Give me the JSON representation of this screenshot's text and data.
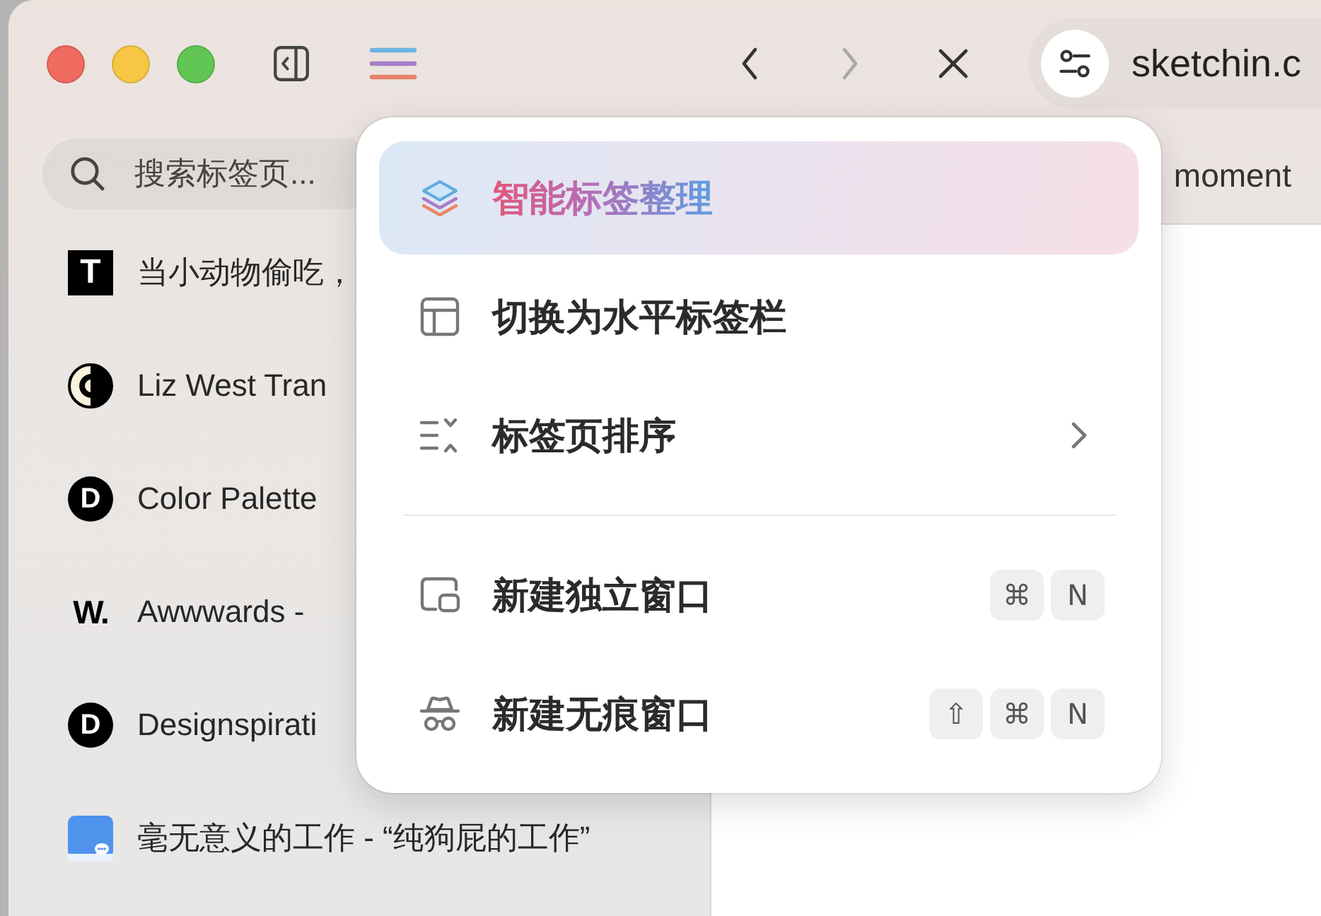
{
  "toolbar": {
    "back": {
      "disabled": false
    },
    "forward": {
      "disabled": true
    },
    "address": {
      "text": "sketchin.c"
    }
  },
  "sidebar": {
    "search": {
      "placeholder": "搜索标签页..."
    },
    "tabs": [
      {
        "title": "当小动物偷吃，",
        "favicon": {
          "kind": "square",
          "letter": "T"
        }
      },
      {
        "title": "Liz West Tran",
        "favicon": {
          "kind": "half-disc"
        }
      },
      {
        "title": "Color Palette",
        "favicon": {
          "kind": "disc",
          "letter": "D"
        }
      },
      {
        "title": "Awwwards -",
        "favicon": {
          "kind": "plain",
          "letter": "W."
        }
      },
      {
        "title": "Designspirati",
        "favicon": {
          "kind": "disc",
          "letter": "D"
        }
      },
      {
        "title": "毫无意义的工作 - “纯狗屁的工作”",
        "favicon": {
          "kind": "chat"
        }
      }
    ]
  },
  "content": {
    "heading": "moment"
  },
  "menu": {
    "sections": [
      {
        "items": [
          {
            "kind": "organize",
            "label": "智能标签整理",
            "selected": true,
            "submenu": false
          },
          {
            "kind": "layout",
            "label": "切换为水平标签栏",
            "selected": false,
            "submenu": false
          },
          {
            "kind": "sort",
            "label": "标签页排序",
            "selected": false,
            "submenu": true
          }
        ]
      },
      {
        "items": [
          {
            "kind": "new-window",
            "label": "新建独立窗口",
            "selected": false,
            "submenu": false,
            "shortcut": [
              "⌘",
              "N"
            ]
          },
          {
            "kind": "private-window",
            "label": "新建无痕窗口",
            "selected": false,
            "submenu": false,
            "shortcut": [
              "⇧",
              "⌘",
              "N"
            ]
          }
        ]
      }
    ]
  }
}
